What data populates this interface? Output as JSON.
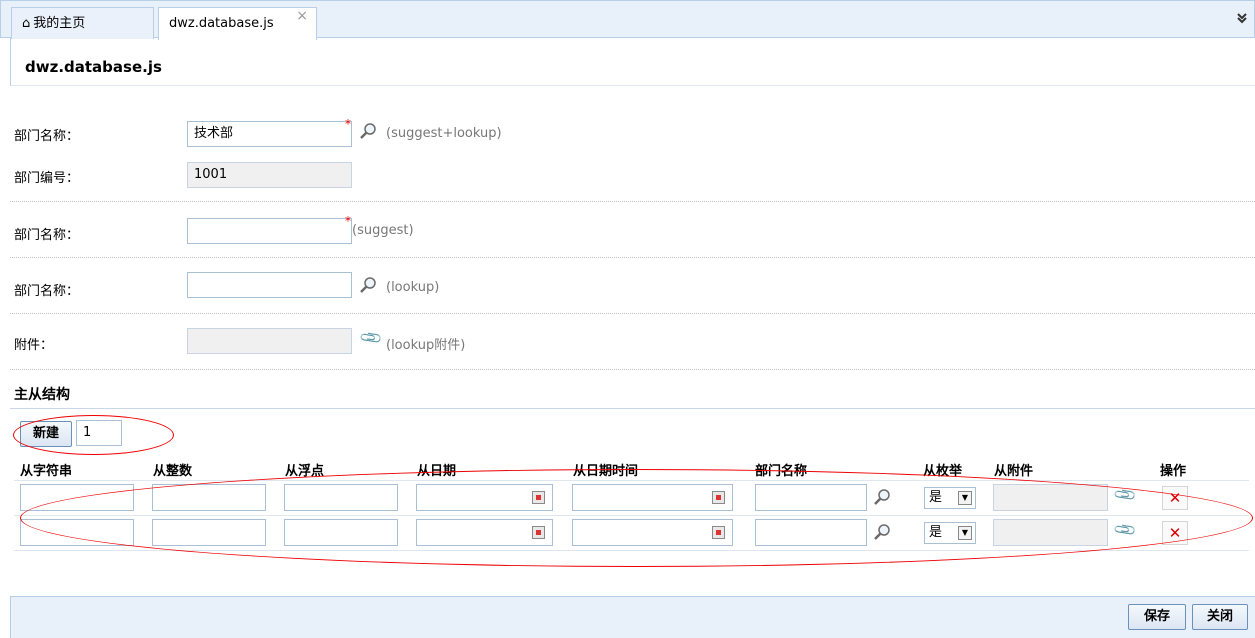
{
  "tabs": {
    "home_label": "我的主页",
    "active_label": "dwz.database.js",
    "close_glyph": "×",
    "expand_glyph": "»"
  },
  "panel": {
    "title": "dwz.database.js"
  },
  "form": {
    "row1": {
      "label": "部门名称：",
      "value": "技术部",
      "required": "*",
      "hint": "(suggest+lookup)"
    },
    "row2": {
      "label": "部门编号：",
      "value": "1001"
    },
    "row3": {
      "label": "部门名称：",
      "value": "",
      "required": "*",
      "hint": "(suggest)"
    },
    "row4": {
      "label": "部门名称：",
      "value": "",
      "hint": "(lookup)"
    },
    "row5": {
      "label": "附件：",
      "value": "",
      "hint": "(lookup附件)"
    }
  },
  "section": {
    "title": "主从结构"
  },
  "detail": {
    "new_button": "新建",
    "row_count": "1",
    "headers": [
      "从字符串",
      "从整数",
      "从浮点",
      "从日期",
      "从日期时间",
      "部门名称",
      "从枚举",
      "从附件",
      "操作"
    ],
    "enum_value": "是",
    "delete_glyph": "✕"
  },
  "footer": {
    "save_label": "保存",
    "close_label": "关闭"
  },
  "colors": {
    "accent": "#b8cfe8",
    "annotation": "#ee0000",
    "required": "#ee0000"
  }
}
